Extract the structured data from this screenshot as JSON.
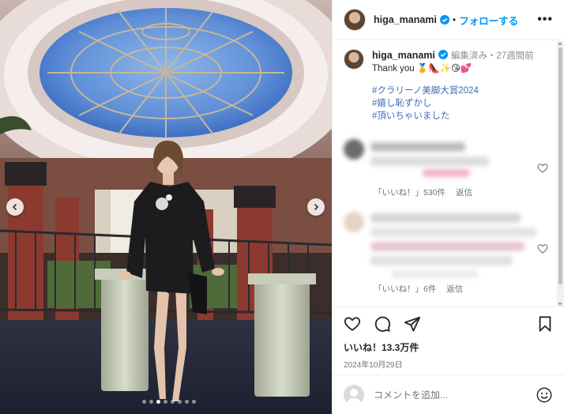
{
  "post": {
    "author": "higa_manami",
    "follow_label": "フォローする",
    "more_label": "•••",
    "separator": "•"
  },
  "caption": {
    "username": "higa_manami",
    "meta": "編集済み・27週間前",
    "text": "Thank you 🏅👠✨😘💕",
    "hashtags": [
      "#クラリーノ美脚大賞2024",
      "#嬉し恥ずかし",
      "#頂いちゃいました"
    ]
  },
  "comments": [
    {
      "likes": "「いいね！」530件",
      "reply": "返信"
    },
    {
      "likes": "「いいね！」6件",
      "reply": "返信"
    }
  ],
  "actions": {
    "icons": [
      "heart-icon",
      "comment-icon",
      "share-icon",
      "bookmark-icon"
    ],
    "likes": "いいね！13.3万件",
    "date": "2024年10月29日"
  },
  "comment_box": {
    "placeholder": "コメントを追加..."
  },
  "carousel": {
    "slide_count": 8,
    "active_index": 2
  },
  "colors": {
    "follow_blue": "#0095f6",
    "hashtag": "#3b6fb6",
    "verified": "#0095f6"
  }
}
